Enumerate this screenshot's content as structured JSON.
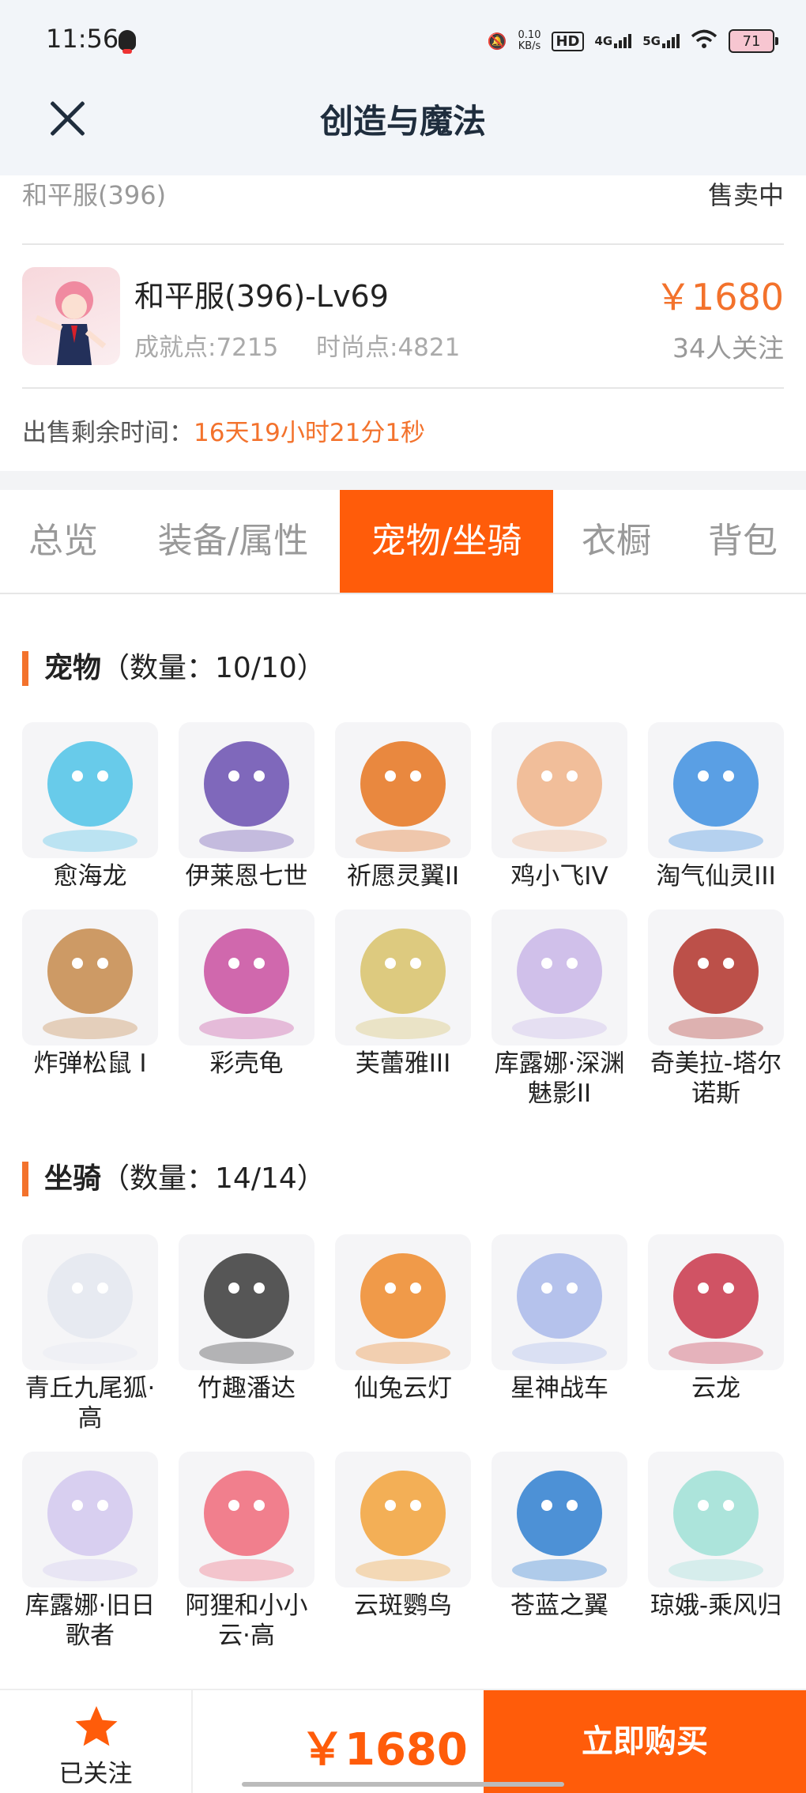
{
  "status": {
    "time": "11:56",
    "net_speed": "0.10",
    "net_unit": "KB/s",
    "hd": "HD",
    "sig1": "4G",
    "sig2": "5G",
    "battery": "71"
  },
  "nav": {
    "title": "创造与魔法"
  },
  "server": {
    "name": "和平服(396)",
    "state": "售卖中"
  },
  "account": {
    "name": "和平服(396)-Lv69",
    "achievement": "成就点:7215",
    "fashion": "时尚点:4821",
    "price": "￥1680",
    "followers": "34人关注"
  },
  "timer": {
    "label": "出售剩余时间：",
    "value": "16天19小时21分1秒"
  },
  "tabs": [
    {
      "label": "总览"
    },
    {
      "label": "装备/属性"
    },
    {
      "label": "宠物/坐骑"
    },
    {
      "label": "衣橱"
    },
    {
      "label": "背包"
    }
  ],
  "pets": {
    "title": "宠物",
    "count": "（数量：10/10）",
    "items": [
      {
        "label": "愈海龙",
        "color": "#4fc3e8"
      },
      {
        "label": "伊莱恩七世",
        "color": "#6a4fb0"
      },
      {
        "label": "祈愿灵翼II",
        "color": "#e6741f"
      },
      {
        "label": "鸡小飞IV",
        "color": "#f0b48a"
      },
      {
        "label": "淘气仙灵III",
        "color": "#3e8fe0"
      },
      {
        "label": "炸弹松鼠 I",
        "color": "#c6894b"
      },
      {
        "label": "彩壳龟",
        "color": "#c94fa0"
      },
      {
        "label": "芙蕾雅III",
        "color": "#d8c26a"
      },
      {
        "label": "库露娜·深渊魅影II",
        "color": "#c9b6e8"
      },
      {
        "label": "奇美拉-塔尔诺斯",
        "color": "#b2332a"
      }
    ]
  },
  "mounts": {
    "title": "坐骑",
    "count": "（数量：14/14）",
    "items": [
      {
        "label": "青丘九尾狐·高",
        "color": "#e4e8f0"
      },
      {
        "label": "竹趣潘达",
        "color": "#3a3a3a"
      },
      {
        "label": "仙兔云灯",
        "color": "#ef8a2a"
      },
      {
        "label": "星神战车",
        "color": "#a9b9ea"
      },
      {
        "label": "云龙",
        "color": "#c9364a"
      },
      {
        "label": "库露娜·旧日歌者",
        "color": "#d2c8ee"
      },
      {
        "label": "阿狸和小小云·高",
        "color": "#f06a7a"
      },
      {
        "label": "云斑鹦鸟",
        "color": "#f2a23a"
      },
      {
        "label": "苍蓝之翼",
        "color": "#2f7fd0"
      },
      {
        "label": "琼娥-乘风归",
        "color": "#9fe0d6"
      }
    ]
  },
  "bottom": {
    "follow_label": "已关注",
    "price": "￥1680",
    "buy_label": "立即购买"
  }
}
